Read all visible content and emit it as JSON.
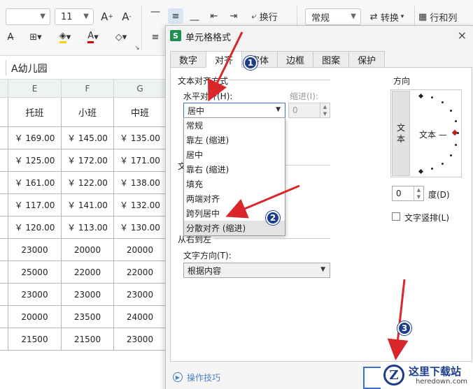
{
  "toolbar": {
    "font_size": "11",
    "font_grow_icon": "A+",
    "font_shrink_icon": "A-",
    "wrap_label": "换行",
    "number_format": "常规",
    "convert_label": "转换",
    "row_col_label": "行和列"
  },
  "formula_bar": {
    "value": "A幼儿园"
  },
  "sheet": {
    "columns": [
      "E",
      "F",
      "G"
    ],
    "header_row": [
      "托班",
      "小班",
      "中班"
    ],
    "rows": [
      [
        "￥ 169.00",
        "￥ 145.00",
        "￥ 135.00"
      ],
      [
        "￥ 125.00",
        "￥ 172.00",
        "￥ 171.00"
      ],
      [
        "￥ 161.00",
        "￥ 122.00",
        "￥ 138.00"
      ],
      [
        "￥ 117.00",
        "￥ 141.00",
        "￥ 132.00"
      ],
      [
        "￥ 120.00",
        "￥ 113.00",
        "￥ 130.00"
      ],
      [
        "23000",
        "20000",
        "20000"
      ],
      [
        "25000",
        "22000",
        "22000"
      ],
      [
        "23000",
        "23000",
        "23000"
      ],
      [
        "20000",
        "23500",
        "24000"
      ],
      [
        "21500",
        "21500",
        "23000"
      ]
    ]
  },
  "dialog": {
    "logo": "S",
    "title": "单元格格式",
    "close": "×",
    "tabs": [
      "数字",
      "对齐",
      "字体",
      "边框",
      "图案",
      "保护"
    ],
    "text_align_section": "文本对齐方式",
    "horizontal_label": "水平对齐(H):",
    "horizontal_value": "居中",
    "indent_label": "缩进(I):",
    "indent_value": "0",
    "options": [
      "常规",
      "靠左 (缩进)",
      "居中",
      "靠右 (缩进)",
      "填充",
      "两端对齐",
      "跨列居中",
      "分散对齐 (缩进)"
    ],
    "text_control_partial": "文",
    "rtl_section": "从右到左",
    "text_direction_label": "文字方向(T):",
    "text_direction_value": "根据内容",
    "orientation_label": "方向",
    "vertical_text": [
      "文",
      "本"
    ],
    "orient_sample": "文本 —",
    "degree_value": "0",
    "degree_label": "度(D)",
    "vertical_stack_label": "文字竖排(L)",
    "tips_label": "操作技巧"
  },
  "annotations": {
    "badges": [
      "1",
      "2",
      "3"
    ]
  },
  "watermark": {
    "name": "这里下载站",
    "domain": "heredown.com"
  },
  "colors": {
    "accent": "#1c3c8c",
    "arrow": "#d9262b",
    "brand": "#1e8f4e"
  }
}
